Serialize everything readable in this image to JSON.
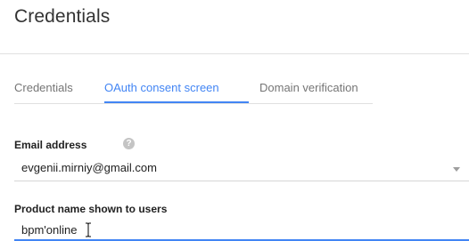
{
  "page": {
    "title": "Credentials"
  },
  "tabs": [
    {
      "label": "Credentials",
      "active": false
    },
    {
      "label": "OAuth consent screen",
      "active": true
    },
    {
      "label": "Domain verification",
      "active": false
    }
  ],
  "form": {
    "email": {
      "label": "Email address",
      "help_icon": "help-circle-icon",
      "help_glyph": "?",
      "value": "evgenii.mirniy@gmail.com",
      "dropdown_icon": "chevron-down-icon"
    },
    "product_name": {
      "label": "Product name shown to users",
      "value": "bpm'online",
      "cursor_icon": "text-cursor-icon"
    }
  },
  "colors": {
    "accent": "#4285f4",
    "muted_text": "#757575",
    "divider": "#e0e0e0",
    "help_icon": "#c4c4c4"
  }
}
